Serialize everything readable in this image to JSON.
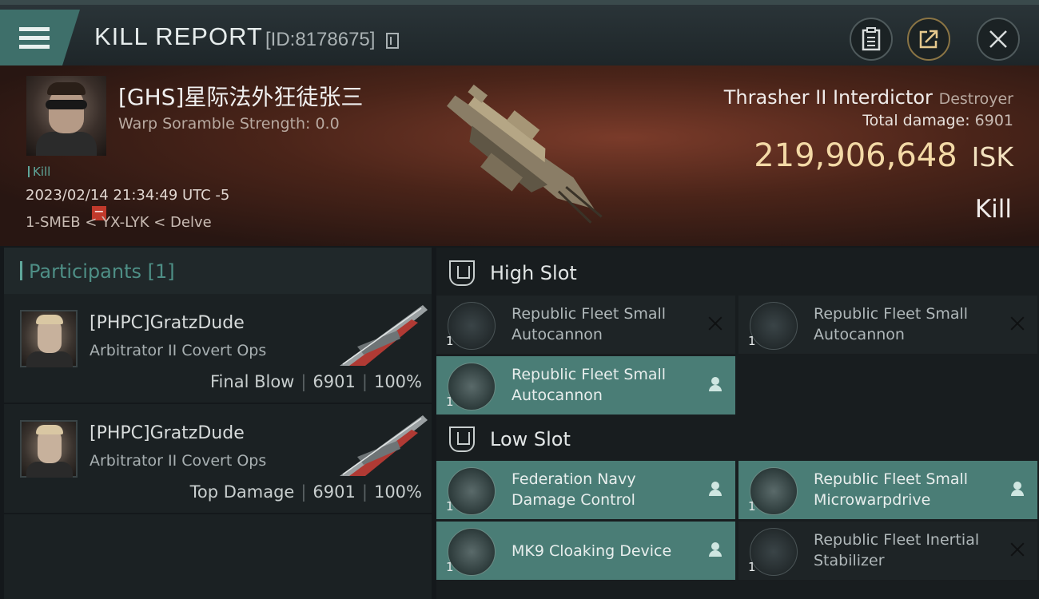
{
  "header": {
    "title": "KILL REPORT",
    "report_id": "[ID:8178675]",
    "icons": [
      "menu-icon",
      "copy-icon",
      "clipboard-icon",
      "share-icon",
      "close-icon"
    ]
  },
  "victim": {
    "name": "[GHS]星际法外狂徒张三",
    "warp_scramble": "Warp Soramble Strength: 0.0",
    "tag": "Kill",
    "datetime": "2023/02/14 21:34:49 UTC -5",
    "location": "1-SMEB < YX-LYK < Delve",
    "ship": "Thrasher II Interdictor",
    "ship_class": "Destroyer",
    "total_damage_label": "Total damage:",
    "total_damage": "6901",
    "isk_value": "219,906,648",
    "isk_unit": "ISK",
    "result": "Kill"
  },
  "participants": {
    "title": "Participants [1]",
    "rows": [
      {
        "name": "[PHPC]GratzDude",
        "ship": "Arbitrator II Covert Ops",
        "role": "Final Blow",
        "damage": "6901",
        "percent": "100%"
      },
      {
        "name": "[PHPC]GratzDude",
        "ship": "Arbitrator II Covert Ops",
        "role": "Top Damage",
        "damage": "6901",
        "percent": "100%"
      }
    ]
  },
  "slots": {
    "high": {
      "label": "High Slot",
      "modules": [
        {
          "name": "Republic Fleet Small Autocannon",
          "qty": "1",
          "status": "destroyed",
          "icon": "autocannon-icon"
        },
        {
          "name": "Republic Fleet Small Autocannon",
          "qty": "1",
          "status": "destroyed",
          "icon": "autocannon-icon"
        },
        {
          "name": "Republic Fleet Small Autocannon",
          "qty": "1",
          "status": "dropped",
          "icon": "autocannon-icon"
        }
      ]
    },
    "low": {
      "label": "Low Slot",
      "modules": [
        {
          "name": "Federation Navy Damage Control",
          "qty": "1",
          "status": "dropped",
          "icon": "damage-control-icon"
        },
        {
          "name": "Republic Fleet Small Microwarpdrive",
          "qty": "1",
          "status": "dropped",
          "icon": "microwarpdrive-icon"
        },
        {
          "name": "MK9 Cloaking Device",
          "qty": "1",
          "status": "dropped",
          "icon": "cloaking-device-icon"
        },
        {
          "name": "Republic Fleet Inertial Stabilizer",
          "qty": "1",
          "status": "destroyed",
          "icon": "inertial-stabilizer-icon"
        }
      ]
    }
  },
  "colors": {
    "accent": "#4a7d76",
    "isk": "#f3d9a6",
    "hero_bg": "#4a2419"
  }
}
